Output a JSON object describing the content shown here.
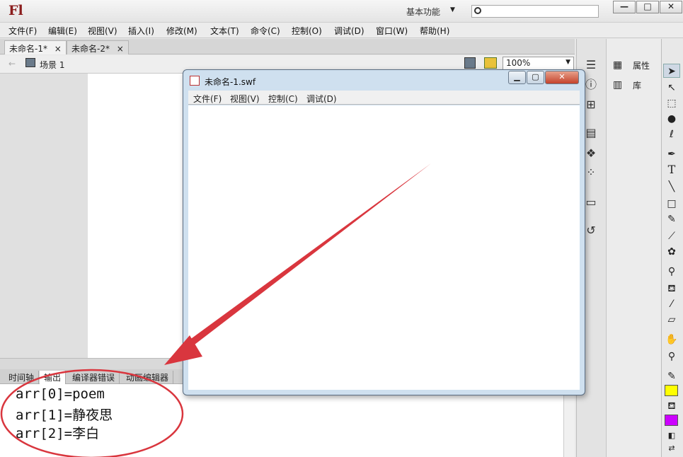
{
  "app": {
    "logo": "Fl",
    "workspace": "基本功能",
    "search_placeholder": ""
  },
  "window_controls": {
    "minimize": "—",
    "maximize": "□",
    "close": "✕"
  },
  "menu": [
    "文件(F)",
    "编辑(E)",
    "视图(V)",
    "插入(I)",
    "修改(M)",
    "文本(T)",
    "命令(C)",
    "控制(O)",
    "调试(D)",
    "窗口(W)",
    "帮助(H)"
  ],
  "doc_tabs": [
    {
      "label": "未命名-1*",
      "close": "×"
    },
    {
      "label": "未命名-2*",
      "close": "×"
    }
  ],
  "editbar": {
    "scene": "场景 1",
    "zoom": "100%"
  },
  "panel_tabs": [
    "时间轴",
    "输出",
    "编译器错误",
    "动画编辑器"
  ],
  "output_lines": [
    "arr[0]=poem",
    "arr[1]=静夜思",
    "arr[2]=李白"
  ],
  "right_panel": {
    "properties": "属性",
    "library": "库"
  },
  "swf_window": {
    "title": "未命名-1.swf",
    "menu": [
      "文件(F)",
      "视图(V)",
      "控制(C)",
      "调试(D)"
    ],
    "controls": {
      "minimize": "▁",
      "maximize": "▢",
      "close": "✕"
    }
  },
  "colors": {
    "fill_color": "#ffff00",
    "stroke_color": "#cc00ff",
    "annotation": "#d9363e"
  }
}
